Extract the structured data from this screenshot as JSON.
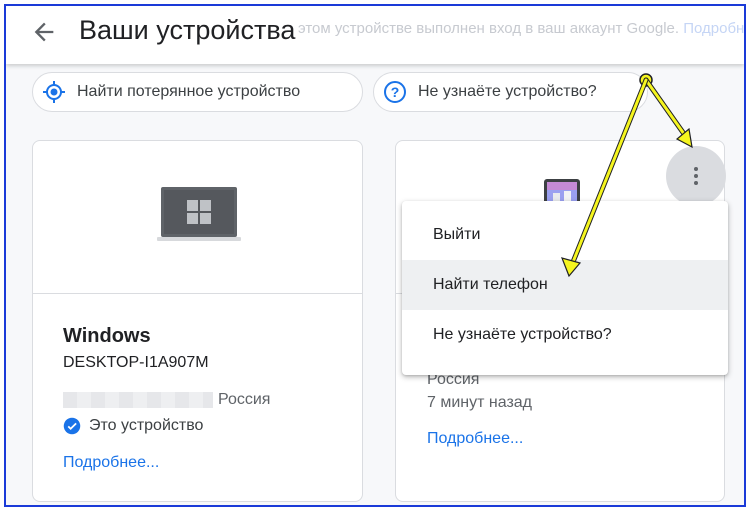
{
  "header": {
    "back_icon": "arrow-left-icon",
    "title": "Ваши устройства",
    "notice": "этом устройстве выполнен вход в ваш аккаунт Google.",
    "notice_more": "Подробнее..."
  },
  "actions": {
    "find_lost": {
      "label": "Найти потерянное устройство",
      "icon": "locate-icon"
    },
    "unknown_device": {
      "label": "Не узнаёте устройство?",
      "icon": "help-circle-icon"
    }
  },
  "devices": [
    {
      "name": "Windows",
      "model": "DESKTOP-I1A907M",
      "country": "Россия",
      "this_device": "Это устройство",
      "more": "Подробнее..."
    },
    {
      "country": "Россия",
      "last_seen": "7 минут назад",
      "more": "Подробнее..."
    }
  ],
  "menu": {
    "items": [
      {
        "label": "Выйти"
      },
      {
        "label": "Найти телефон"
      },
      {
        "label": "Не узнаёте устройство?"
      }
    ]
  },
  "colors": {
    "accent": "#1a73e8",
    "frame_border": "#1a3ad8",
    "arrow_fill": "#f5f51f"
  }
}
